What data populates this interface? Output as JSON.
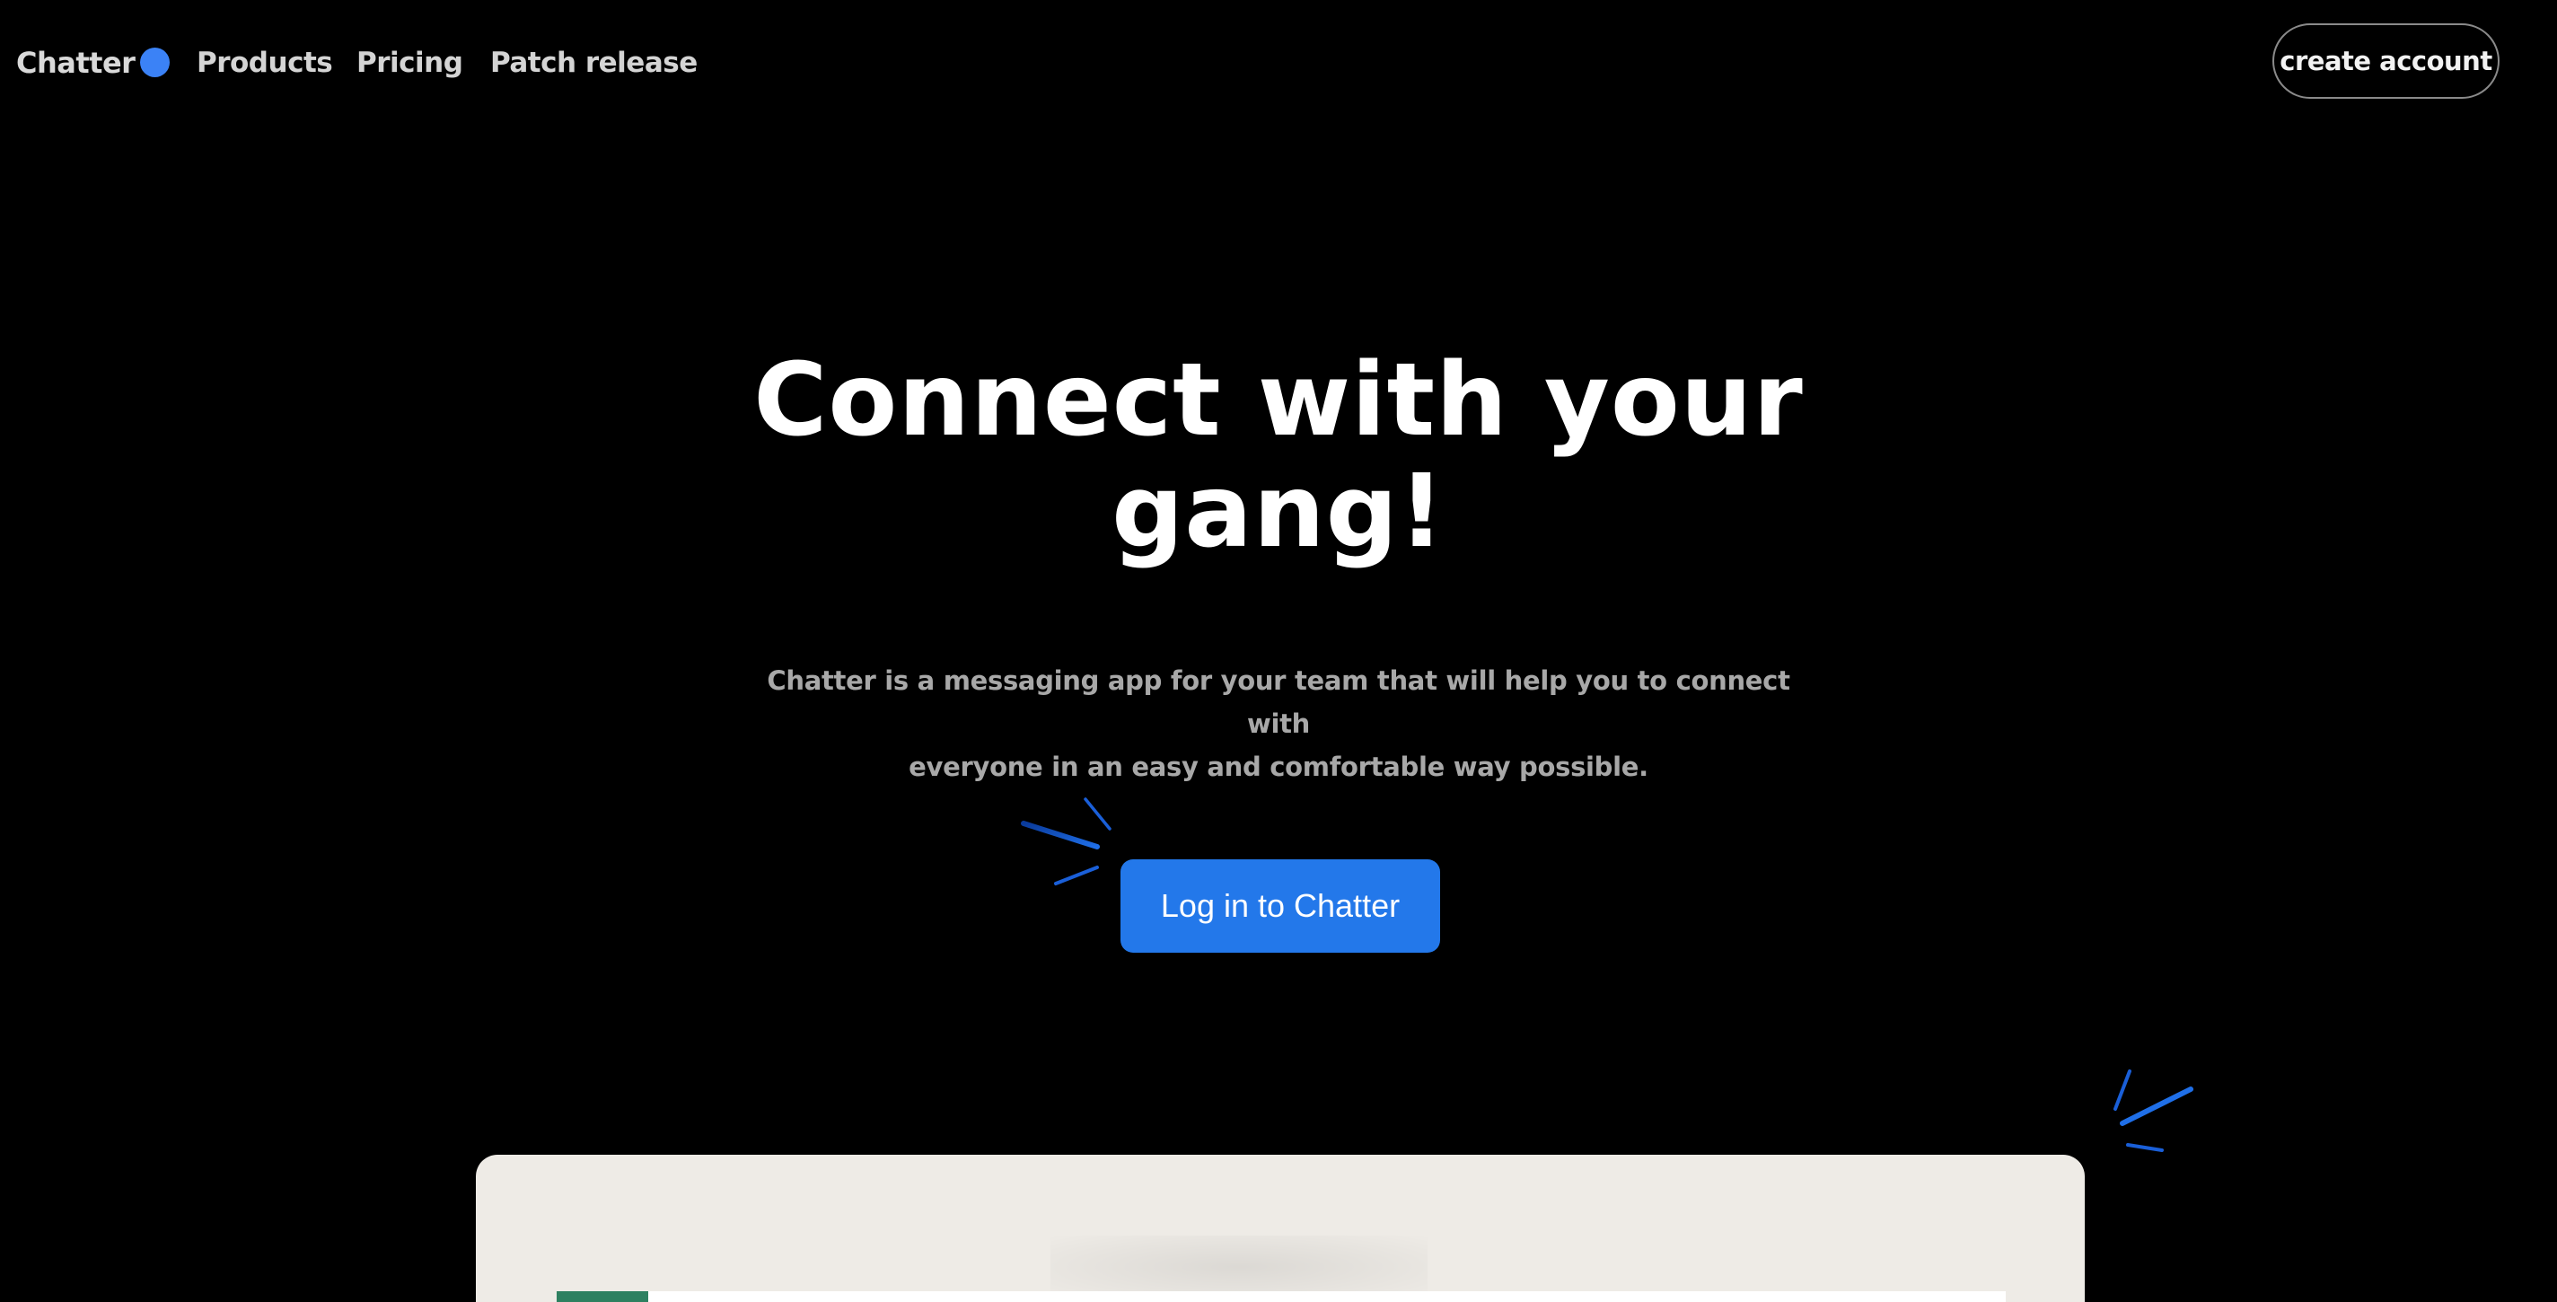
{
  "nav": {
    "brand": "Chatter",
    "links": [
      "Products",
      "Pricing",
      "Patch release"
    ],
    "create_account": "create account"
  },
  "hero": {
    "title_line1": "Connect with your",
    "title_line2": "gang!",
    "subtitle_line1": "Chatter is a messaging app for your team that will help you to connect with",
    "subtitle_line2": "everyone in an easy and comfortable way possible.",
    "cta_label": "Log in to Chatter"
  },
  "colors": {
    "background": "#000000",
    "accent_blue": "#2378ea",
    "brand_dot": "#3b82f6",
    "preview_bg": "#eeebe6",
    "preview_accent": "#2e8060"
  },
  "icons": {
    "brand_mark": "blue-dot-icon",
    "decor_left": "sparkle-icon",
    "decor_right": "sparkle-icon"
  }
}
